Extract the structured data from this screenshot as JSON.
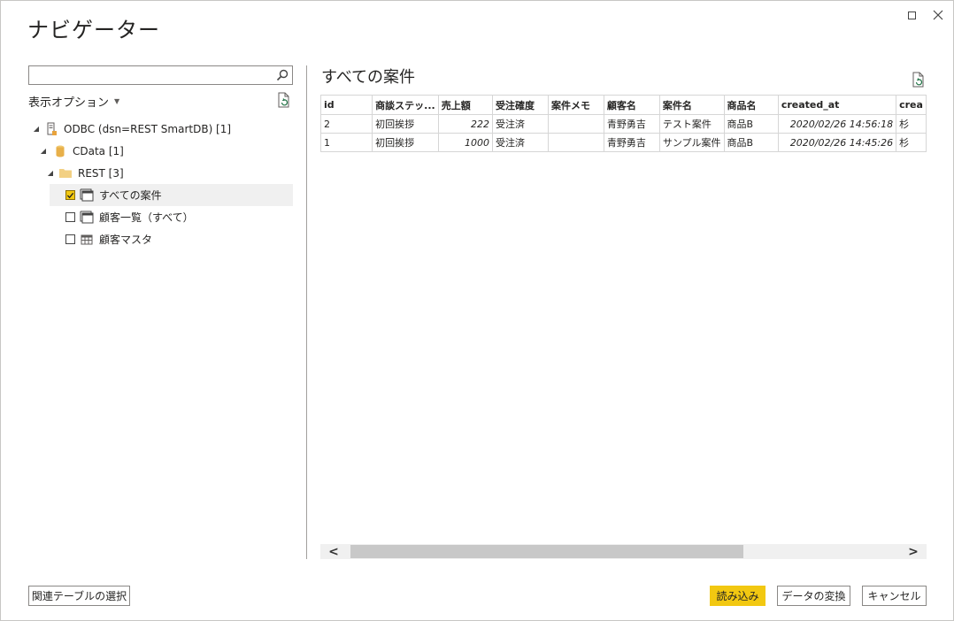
{
  "window": {
    "title": "ナビゲーター"
  },
  "left": {
    "search": {
      "placeholder": "",
      "value": ""
    },
    "display_options": "表示オプション",
    "tree": [
      {
        "label": "ODBC (dsn=REST SmartDB) [1]",
        "icon": "database-server-icon",
        "expanded": true,
        "level": 0
      },
      {
        "label": "CData [1]",
        "icon": "database-cylinder-icon",
        "expanded": true,
        "level": 1
      },
      {
        "label": "REST [3]",
        "icon": "folder-icon",
        "expanded": true,
        "level": 2
      },
      {
        "label": "すべての案件",
        "icon": "view-icon",
        "checked": true,
        "selected": true,
        "level": 3
      },
      {
        "label": "顧客一覧（すべて）",
        "icon": "view-icon",
        "checked": false,
        "level": 3
      },
      {
        "label": "顧客マスタ",
        "icon": "table-icon",
        "checked": false,
        "level": 3
      }
    ]
  },
  "preview": {
    "title": "すべての案件",
    "columns": [
      "id",
      "商談ステッ...",
      "売上額",
      "受注確度",
      "案件メモ",
      "顧客名",
      "案件名",
      "商品名",
      "created_at",
      "crea"
    ],
    "rows": [
      [
        "2",
        "初回挨拶",
        "222",
        "受注済",
        "",
        "青野勇吉",
        "テスト案件",
        "商品B",
        "2020/02/26 14:56:18",
        "杉"
      ],
      [
        "1",
        "初回挨拶",
        "1000",
        "受注済",
        "",
        "青野勇吉",
        "サンプル案件",
        "商品B",
        "2020/02/26 14:45:26",
        "杉"
      ]
    ]
  },
  "buttons": {
    "related": "関連テーブルの選択",
    "load": "読み込み",
    "transform": "データの変換",
    "cancel": "キャンセル"
  },
  "colors": {
    "accent": "#f2c811",
    "border": "#8a8886"
  }
}
